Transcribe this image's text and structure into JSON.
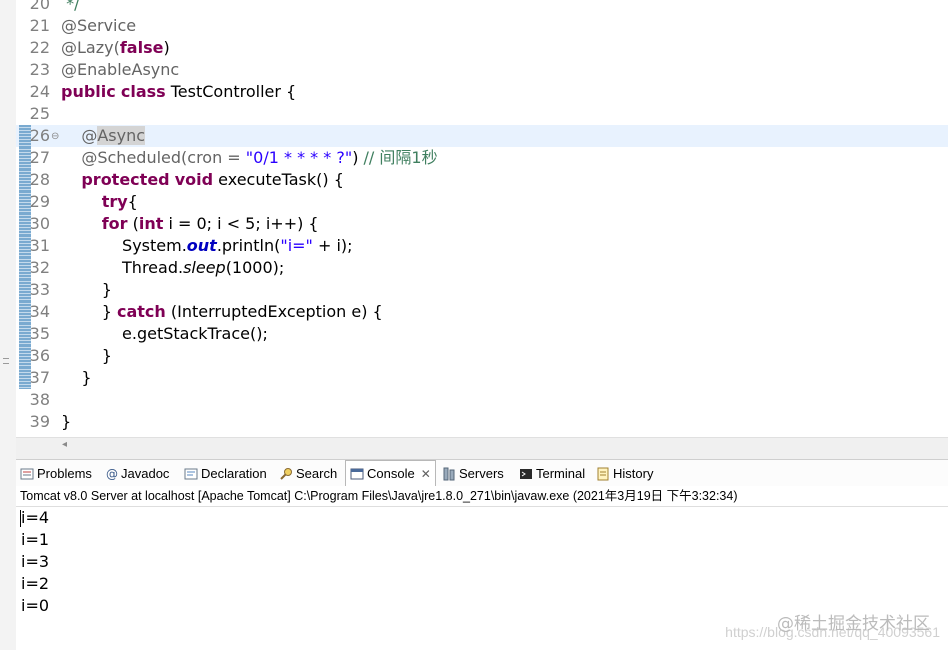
{
  "editor": {
    "lines": [
      {
        "num": "20",
        "parts": [
          {
            "t": " */",
            "c": "com"
          }
        ]
      },
      {
        "num": "21",
        "parts": [
          {
            "t": "@Service",
            "c": "anno"
          }
        ]
      },
      {
        "num": "22",
        "parts": [
          {
            "t": "@Lazy(",
            "c": "anno"
          },
          {
            "t": "false",
            "c": "kw"
          },
          {
            "t": ")",
            "c": ""
          }
        ]
      },
      {
        "num": "23",
        "parts": [
          {
            "t": "@EnableAsync",
            "c": "anno"
          }
        ]
      },
      {
        "num": "24",
        "parts": [
          {
            "t": "public",
            "c": "kw"
          },
          {
            "t": " ",
            "c": ""
          },
          {
            "t": "class",
            "c": "kw"
          },
          {
            "t": " TestController {",
            "c": ""
          }
        ]
      },
      {
        "num": "25",
        "parts": []
      },
      {
        "num": "26",
        "highlight": true,
        "fold": true,
        "parts": [
          {
            "t": "    @",
            "c": "anno"
          },
          {
            "t": "Async",
            "c": "anno anno-sel"
          }
        ]
      },
      {
        "num": "27",
        "parts": [
          {
            "t": "    @Scheduled(cron = ",
            "c": "anno"
          },
          {
            "t": "\"0/1 * * * * ?\"",
            "c": "str"
          },
          {
            "t": ") ",
            "c": ""
          },
          {
            "t": "// 间隔1秒",
            "c": "com"
          }
        ]
      },
      {
        "num": "28",
        "parts": [
          {
            "t": "    ",
            "c": ""
          },
          {
            "t": "protected",
            "c": "kw"
          },
          {
            "t": " ",
            "c": ""
          },
          {
            "t": "void",
            "c": "kw"
          },
          {
            "t": " executeTask() {",
            "c": ""
          }
        ]
      },
      {
        "num": "29",
        "parts": [
          {
            "t": "        ",
            "c": ""
          },
          {
            "t": "try",
            "c": "kw"
          },
          {
            "t": "{",
            "c": ""
          }
        ]
      },
      {
        "num": "30",
        "parts": [
          {
            "t": "        ",
            "c": ""
          },
          {
            "t": "for",
            "c": "kw"
          },
          {
            "t": " (",
            "c": ""
          },
          {
            "t": "int",
            "c": "kw"
          },
          {
            "t": " i = 0; i < 5; i++) {",
            "c": ""
          }
        ]
      },
      {
        "num": "31",
        "parts": [
          {
            "t": "            System.",
            "c": ""
          },
          {
            "t": "out",
            "c": "fld"
          },
          {
            "t": ".println(",
            "c": ""
          },
          {
            "t": "\"i=\"",
            "c": "str"
          },
          {
            "t": " + i);",
            "c": ""
          }
        ]
      },
      {
        "num": "32",
        "parts": [
          {
            "t": "            Thread.",
            "c": ""
          },
          {
            "t": "sleep",
            "c": "ital"
          },
          {
            "t": "(1000);",
            "c": ""
          }
        ]
      },
      {
        "num": "33",
        "parts": [
          {
            "t": "        }",
            "c": ""
          }
        ]
      },
      {
        "num": "34",
        "parts": [
          {
            "t": "        } ",
            "c": ""
          },
          {
            "t": "catch",
            "c": "kw"
          },
          {
            "t": " (InterruptedException e) {",
            "c": ""
          }
        ]
      },
      {
        "num": "35",
        "parts": [
          {
            "t": "            e.getStackTrace();",
            "c": ""
          }
        ]
      },
      {
        "num": "36",
        "parts": [
          {
            "t": "        }",
            "c": ""
          }
        ]
      },
      {
        "num": "37",
        "parts": [
          {
            "t": "    }",
            "c": ""
          }
        ]
      },
      {
        "num": "38",
        "parts": []
      },
      {
        "num": "39",
        "parts": [
          {
            "t": "}",
            "c": ""
          }
        ]
      }
    ]
  },
  "tabs": [
    {
      "label": "Problems",
      "icon": "problems-icon"
    },
    {
      "label": "Javadoc",
      "icon": "javadoc-icon"
    },
    {
      "label": "Declaration",
      "icon": "declaration-icon"
    },
    {
      "label": "Search",
      "icon": "search-icon"
    },
    {
      "label": "Console",
      "icon": "console-icon",
      "active": true,
      "close": "✕"
    },
    {
      "label": "Servers",
      "icon": "servers-icon"
    },
    {
      "label": "Terminal",
      "icon": "terminal-icon"
    },
    {
      "label": "History",
      "icon": "history-icon"
    }
  ],
  "console": {
    "description": "Tomcat v8.0 Server at localhost [Apache Tomcat] C:\\Program Files\\Java\\jre1.8.0_271\\bin\\javaw.exe (2021年3月19日 下午3:32:34)",
    "output": [
      "i=4",
      "i=1",
      "i=3",
      "i=2",
      "i=0"
    ]
  },
  "watermark": {
    "name": "@稀土掘金技术社区",
    "url": "https://blog.csdn.net/qq_40093561"
  },
  "colors": {
    "keyword": "#7f0055",
    "string": "#2a00ff",
    "comment": "#3f7f5f",
    "annotation": "#646464",
    "highlight": "#e8f2fe"
  }
}
